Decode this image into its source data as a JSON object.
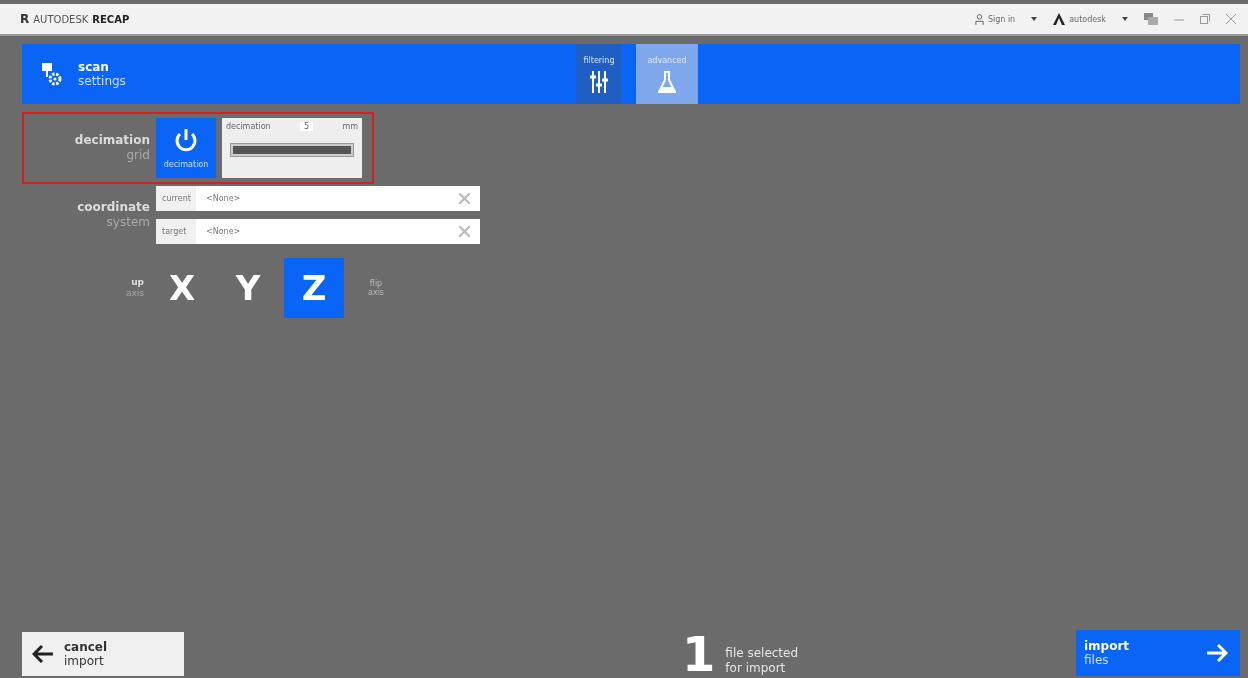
{
  "window": {
    "logo": "R",
    "title_prefix": "AUTODESK",
    "title": "RECAP",
    "sign_in": "Sign in",
    "user": "autodesk"
  },
  "header": {
    "title": "scan",
    "subtitle": "settings"
  },
  "tabs": [
    {
      "label": "filtering",
      "kind": "sliders",
      "selected": false
    },
    {
      "label": "advanced",
      "kind": "flask",
      "selected": true
    }
  ],
  "decimation": {
    "label": "decimation",
    "sublabel": "grid",
    "highlighted": true,
    "power_label": "decimation",
    "on": true,
    "field_label": "decimation",
    "value": "5",
    "unit": "mm",
    "level": 1
  },
  "coordinate": {
    "label": "coordinate",
    "sublabel": "system",
    "fields": [
      {
        "label": "current",
        "value": "<None>"
      },
      {
        "label": "target",
        "value": "<None>"
      }
    ]
  },
  "up_axis": {
    "label": "up",
    "sublabel": "axis",
    "axes": [
      {
        "label": "X",
        "selected": false
      },
      {
        "label": "Y",
        "selected": false
      },
      {
        "label": "Z",
        "selected": true
      }
    ],
    "flip_label": "flip",
    "flip_sublabel": "axis"
  },
  "footer": {
    "cancel": {
      "title": "cancel",
      "subtitle": "import"
    },
    "count": "1",
    "count_line1": "file selected",
    "count_line2": "for import",
    "import": {
      "title": "import",
      "subtitle": "files"
    }
  }
}
